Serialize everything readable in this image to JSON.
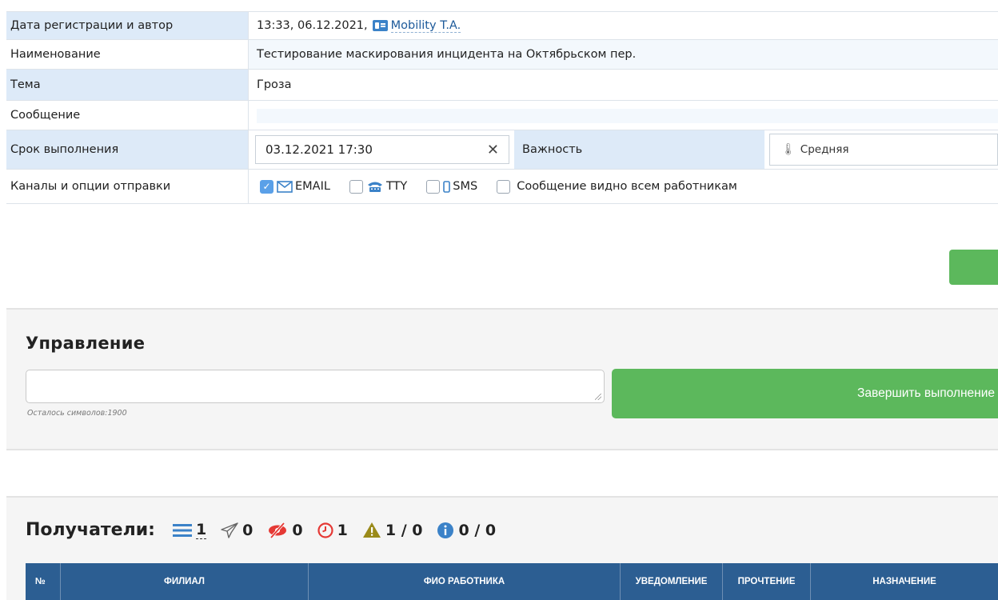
{
  "details": {
    "reg_label": "Дата регистрации и автор",
    "reg_value": "13:33, 06.12.2021,",
    "author": "Mobility T.A.",
    "name_label": "Наименование",
    "name_value": "Тестирование маскирования инцидента на Октябрьском пер.",
    "topic_label": "Тема",
    "topic_value": "Гроза",
    "message_label": "Сообщение",
    "deadline_label": "Срок выполнения",
    "deadline_value": "03.12.2021 17:30",
    "importance_label": "Важность",
    "importance_value": "Средняя",
    "channels_label": "Каналы и опции отправки",
    "channels": {
      "email": {
        "label": "EMAIL",
        "checked": true
      },
      "tty": {
        "label": "TTY",
        "checked": false
      },
      "sms": {
        "label": "SMS",
        "checked": false
      },
      "visible_all": {
        "label": "Сообщение видно всем работникам",
        "checked": false
      }
    }
  },
  "control": {
    "title": "Управление",
    "counter": "Осталось символов:1900",
    "finish_button": "Завершить выполнение"
  },
  "recipients": {
    "title": "Получатели:",
    "stats": {
      "total": "1",
      "sent": "0",
      "unread": "0",
      "pending": "1",
      "warnings": "1 / 0",
      "info": "0 / 0"
    },
    "columns": [
      "№",
      "ФИЛИАЛ",
      "ФИО РАБОТНИКА",
      "УВЕДОМЛЕНИЕ",
      "ПРОЧТЕНИЕ",
      "НАЗНАЧЕНИЕ"
    ]
  },
  "colors": {
    "accent_green": "#5cb85c",
    "header_blue": "#2c5e92",
    "label_blue": "#ddeaf8"
  }
}
